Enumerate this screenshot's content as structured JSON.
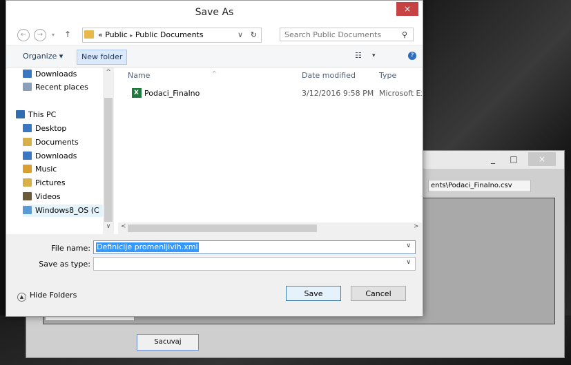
{
  "desktop": {
    "window": {
      "minimize_glyph": "_",
      "maximize_glyph": "□",
      "close_glyph": "×",
      "path_text": "ents\\Podaci_Finalno.csv",
      "save_button_label": "Sacuvaj"
    }
  },
  "dialog": {
    "title": "Save As",
    "close_glyph": "×",
    "nav": {
      "back_glyph": "←",
      "forward_glyph": "→",
      "recent_glyph": "▾",
      "up_glyph": "↑",
      "breadcrumb_prefix": "«",
      "breadcrumb": [
        "Public",
        "Public Documents"
      ],
      "breadcrumb_sep": "▸",
      "dropdown_glyph": "∨",
      "refresh_glyph": "↻",
      "search_placeholder": "Search Public Documents",
      "search_glyph": "⚲"
    },
    "toolbar": {
      "organize_label": "Organize ▾",
      "new_folder_label": "New folder",
      "view_glyph": "☷",
      "view_dropdown_glyph": "▾",
      "help_glyph": "?"
    },
    "nav_pane": {
      "items": [
        {
          "label": "Downloads",
          "icon": "downloads-icon",
          "color": "#3b78c4"
        },
        {
          "label": "Recent places",
          "icon": "recent-places-icon",
          "color": "#8aa0b8"
        },
        {
          "label": "This PC",
          "icon": "computer-icon",
          "color": "#2e6db0"
        },
        {
          "label": "Desktop",
          "icon": "desktop-icon",
          "color": "#3b78c4"
        },
        {
          "label": "Documents",
          "icon": "documents-icon",
          "color": "#d9b048"
        },
        {
          "label": "Downloads",
          "icon": "downloads-icon",
          "color": "#3b78c4"
        },
        {
          "label": "Music",
          "icon": "music-icon",
          "color": "#d9a030"
        },
        {
          "label": "Pictures",
          "icon": "pictures-icon",
          "color": "#d9b048"
        },
        {
          "label": "Videos",
          "icon": "videos-icon",
          "color": "#6b5a3a"
        },
        {
          "label": "Windows8_OS (C",
          "icon": "drive-icon",
          "color": "#5a9bd5"
        }
      ],
      "scroll_up_glyph": "^",
      "scroll_down_glyph": "∨"
    },
    "file_list": {
      "columns": [
        "Name",
        "Date modified",
        "Type"
      ],
      "sort_glyph": "^",
      "files": [
        {
          "name": "Podaci_Finalno",
          "date": "3/12/2016 9:58 PM",
          "type": "Microsoft Ex",
          "icon": "excel-file-icon"
        }
      ],
      "scroll_left_glyph": "<",
      "scroll_right_glyph": ">"
    },
    "file_name_label": "File name:",
    "file_name_value": "Definicije promenljivih.xml",
    "save_as_type_label": "Save as type:",
    "save_as_type_value": "",
    "field_dropdown_glyph": "∨",
    "hide_folders_label": "Hide Folders",
    "hide_folders_glyph": "▲",
    "save_label": "Save",
    "cancel_label": "Cancel"
  }
}
